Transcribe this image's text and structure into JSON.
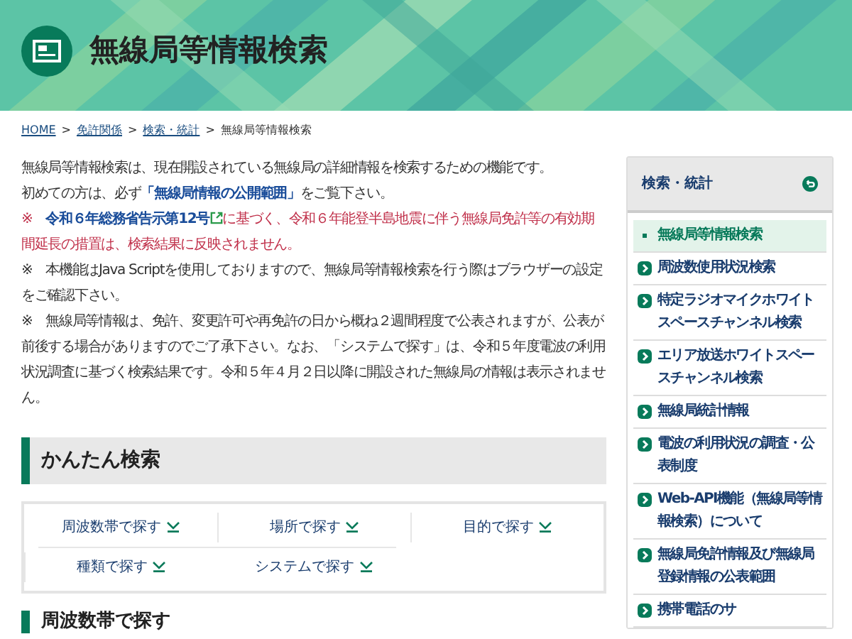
{
  "header": {
    "title": "無線局等情報検索"
  },
  "breadcrumb": [
    {
      "label": "HOME",
      "link": true
    },
    {
      "label": "免許関係",
      "link": true
    },
    {
      "label": "検索・統計",
      "link": true
    },
    {
      "label": "無線局等情報検索",
      "link": false
    }
  ],
  "separator": ">",
  "notes": [
    {
      "kind": "plain",
      "before": "無線局等情報検索は、現在開設されている無線局の詳細情報を検索するための機能です。"
    },
    {
      "kind": "plain",
      "before": "初めての方は、必ず",
      "link": "「無線局情報の公開範囲」",
      "after": "をご覧下さい。"
    },
    {
      "kind": "alert",
      "before": "※　",
      "link": "令和６年総務省告示第12号",
      "external": true,
      "after": "に基づく、令和６年能登半島地震に伴う無線局免許等の有効期間延長の措置は、検索結果に反映されません。"
    },
    {
      "kind": "plain",
      "before": "※　本機能はJava Scriptを使用しておりますので、無線局等情報検索を行う際はブラウザーの設定をご確認下さい。"
    },
    {
      "kind": "plain",
      "before": "※　無線局等情報は、免許、変更許可や再免許の日から概ね２週間程度で公表されますが、公表が前後する場合がありますのでご了承下さい。なお、「システムで探す」は、令和５年度電波の利用状況調査に基づく検索結果です。令和５年４月２日以降に開設された無線局の情報は表示されません。"
    }
  ],
  "easy_search": {
    "heading": "かんたん検索",
    "options": [
      "周波数帯で探す",
      "場所で探す",
      "目的で探す",
      "種類で探す",
      "システムで探す"
    ]
  },
  "next_heading": "周波数帯で探す",
  "sidebar": {
    "title": "検索・統計",
    "items": [
      {
        "label": "無線局等情報検索",
        "selected": true
      },
      {
        "label": "周波数使用状況検索",
        "selected": false
      },
      {
        "label": "特定ラジオマイクホワイトスペースチャンネル検索",
        "selected": false
      },
      {
        "label": "エリア放送ホワイトスペースチャンネル検索",
        "selected": false
      },
      {
        "label": "無線局統計情報",
        "selected": false
      },
      {
        "label": "電波の利用状況の調査・公表制度",
        "selected": false
      },
      {
        "label": "Web-API機能（無線局等情報検索）について",
        "selected": false
      },
      {
        "label": "無線局免許情報及び無線局登録情報の公表範囲",
        "selected": false
      },
      {
        "label": "携帯電話のサ",
        "selected": false
      }
    ]
  }
}
